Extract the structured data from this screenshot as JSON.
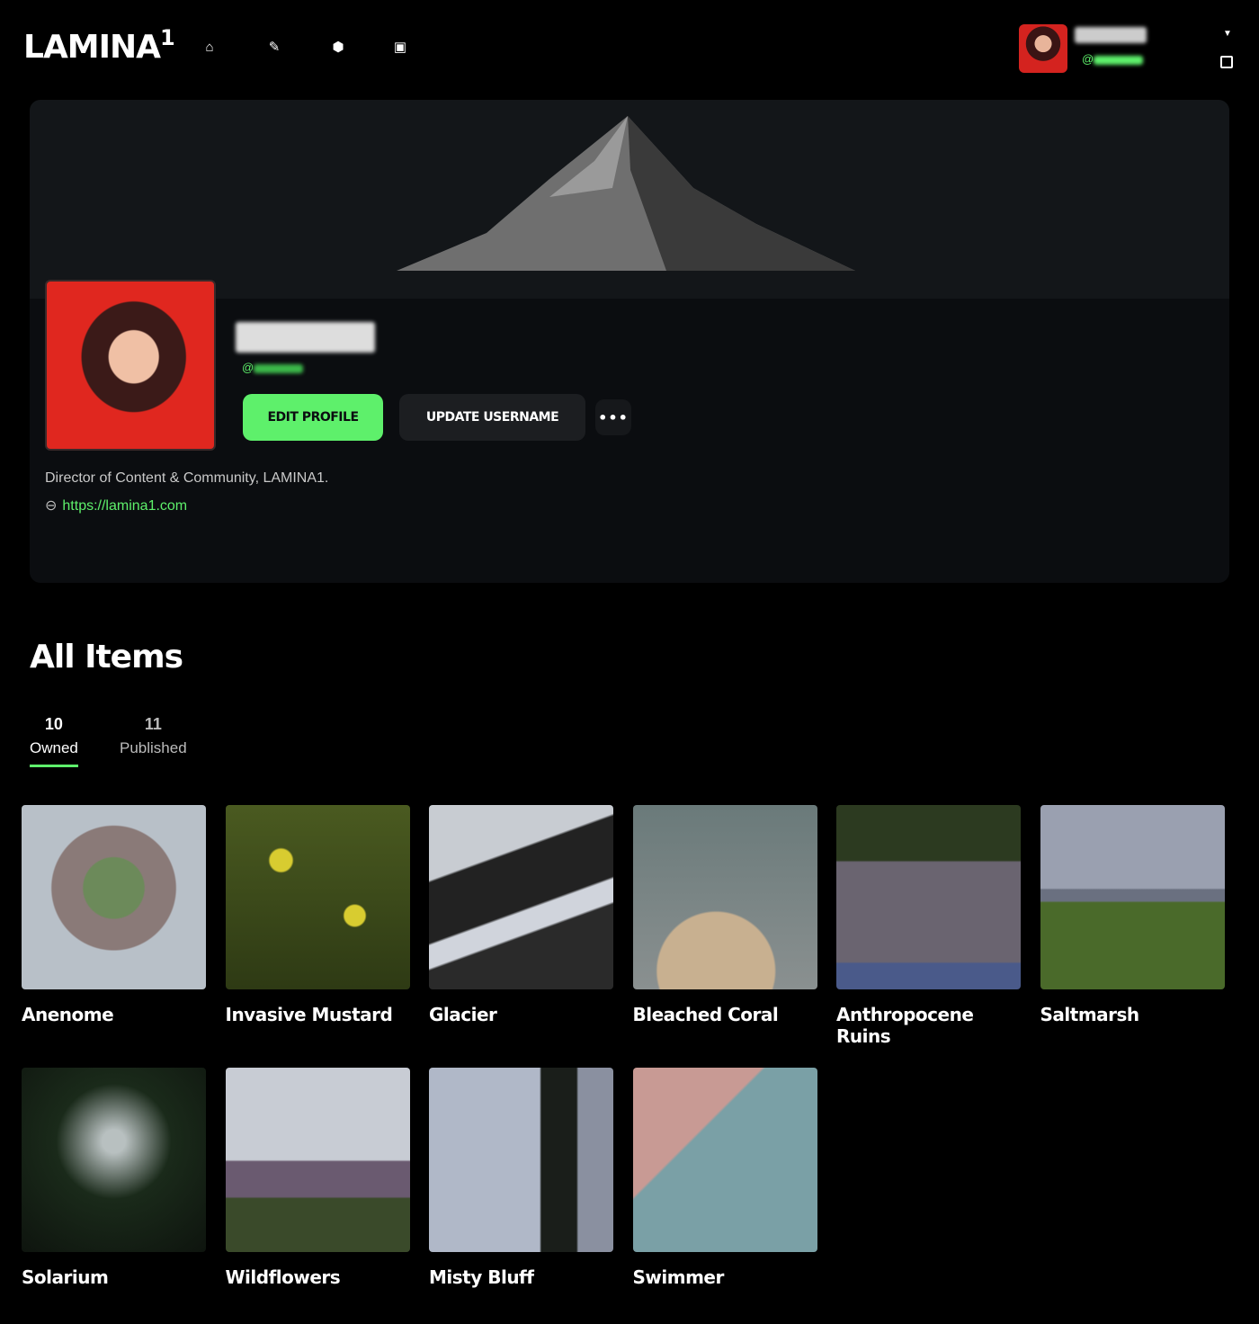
{
  "header": {
    "logo": "LAMINA",
    "logo_sup": "1",
    "nav_icons": [
      "home-icon",
      "brush-icon",
      "cube-icon",
      "wallet-icon"
    ],
    "user_handle_prefix": "@"
  },
  "profile": {
    "handle_prefix": "@",
    "edit_label": "EDIT PROFILE",
    "update_label": "UPDATE USERNAME",
    "more_label": "•••",
    "bio": "Director of Content & Community, LAMINA1.",
    "link": "https://lamina1.com",
    "accent": "#5ef06b"
  },
  "items_section": {
    "title": "All Items",
    "tabs": [
      {
        "count": "10",
        "label": "Owned",
        "active": true
      },
      {
        "count": "11",
        "label": "Published",
        "active": false
      }
    ]
  },
  "items": [
    {
      "title": "Anenome"
    },
    {
      "title": "Invasive Mustard"
    },
    {
      "title": "Glacier"
    },
    {
      "title": "Bleached Coral"
    },
    {
      "title": "Anthropocene Ruins"
    },
    {
      "title": "Saltmarsh"
    },
    {
      "title": "Solarium"
    },
    {
      "title": "Wildflowers"
    },
    {
      "title": "Misty Bluff"
    },
    {
      "title": "Swimmer"
    }
  ]
}
